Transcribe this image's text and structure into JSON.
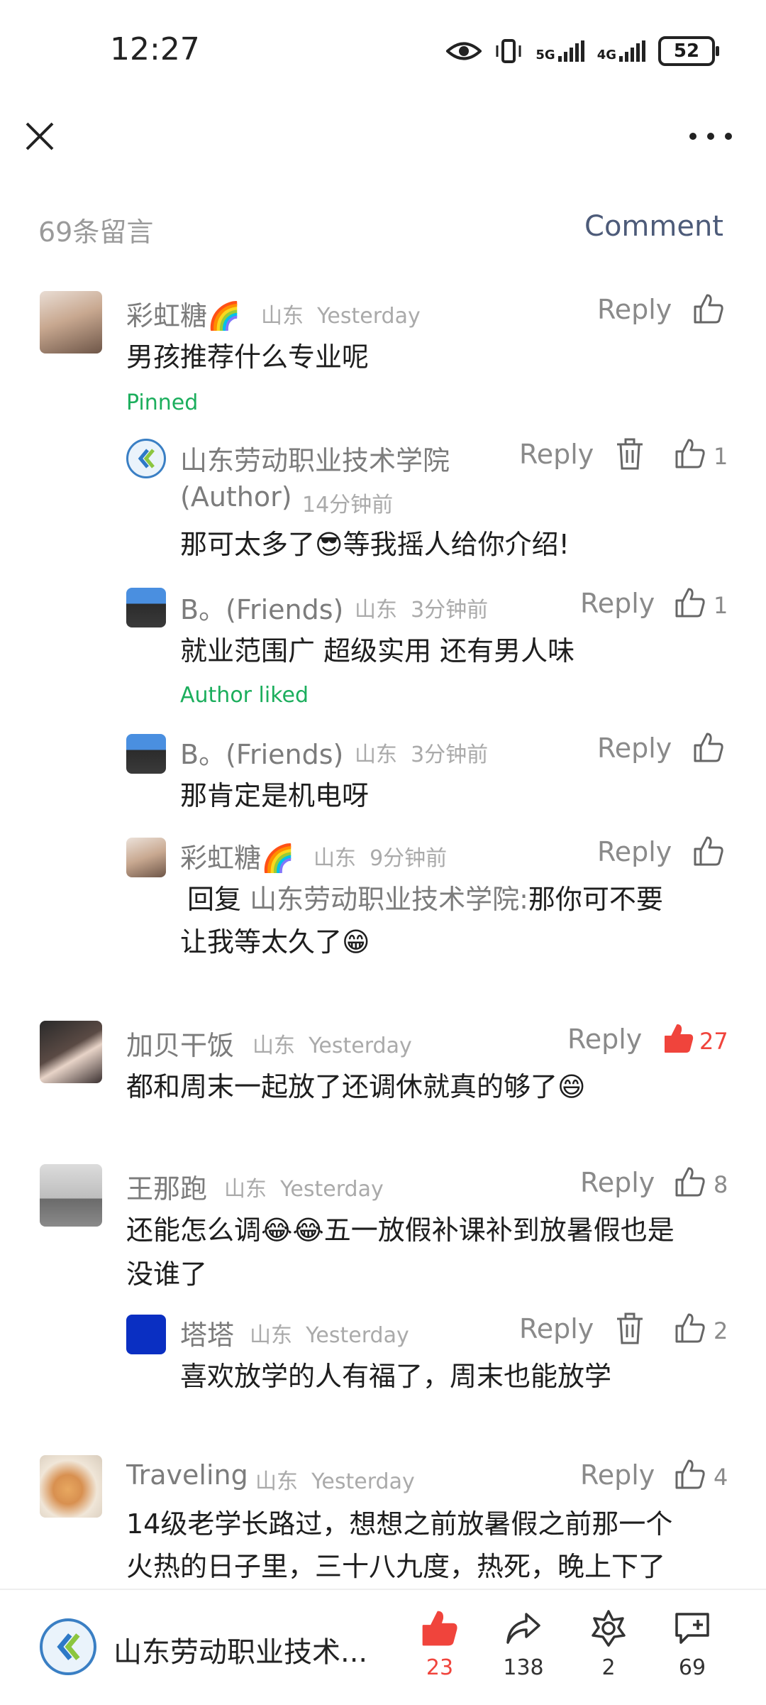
{
  "status": {
    "time": "12:27",
    "net1": "5G",
    "net2": "4G",
    "battery": "52"
  },
  "header": {
    "count": "69条留言",
    "comment_button": "Comment"
  },
  "comments": [
    {
      "name": "彩虹糖🌈",
      "region": "山东",
      "time": "Yesterday",
      "reply": "Reply",
      "text": "男孩推荐什么专业呢",
      "tag": "Pinned",
      "replies": [
        {
          "name_line1": "山东劳动职业技术学院",
          "name_line2": "(Author)",
          "time": "14分钟前",
          "reply": "Reply",
          "likes": "1",
          "text": "那可太多了😎等我摇人给你介绍!"
        },
        {
          "name": "B。(Friends)",
          "region": "山东",
          "time": "3分钟前",
          "reply": "Reply",
          "likes": "1",
          "text": "就业范围广 超级实用 还有男人味",
          "tag": "Author liked"
        },
        {
          "name": "B。(Friends)",
          "region": "山东",
          "time": "3分钟前",
          "reply": "Reply",
          "text": "那肯定是机电呀"
        },
        {
          "name": "彩虹糖🌈",
          "region": "山东",
          "time": "9分钟前",
          "reply": "Reply",
          "reply_prefix": "回复",
          "reply_target": "山东劳动职业技术学院:",
          "text_line1": "那你可不要",
          "text_line2": "让我等太久了😁"
        }
      ]
    },
    {
      "name": "加贝干饭",
      "region": "山东",
      "time": "Yesterday",
      "reply": "Reply",
      "likes": "27",
      "text": "都和周末一起放了还调休就真的够了😄"
    },
    {
      "name": "王那跑",
      "region": "山东",
      "time": "Yesterday",
      "reply": "Reply",
      "likes": "8",
      "text_line1": "还能怎么调😂😂五一放假补课补到放暑假也是",
      "text_line2": "没谁了",
      "replies": [
        {
          "name": "塔塔",
          "region": "山东",
          "time": "Yesterday",
          "reply": "Reply",
          "likes": "2",
          "text": "喜欢放学的人有福了，周末也能放学"
        }
      ]
    },
    {
      "name": "Traveling",
      "region": "山东",
      "time": "Yesterday",
      "reply": "Reply",
      "likes": "4",
      "text_line1": "14级老学长路过，想想之前放暑假之前那一个",
      "text_line2": "火热的日子里，三十八九度，热死，晚上下了"
    }
  ],
  "bottom": {
    "title": "山东劳动职业技术...",
    "likes": "23",
    "shares": "138",
    "stars": "2",
    "comments": "69"
  },
  "colors": {
    "accent_red": "#f0443c",
    "green": "#1cae5d",
    "comment_blue": "#4d5b79"
  }
}
